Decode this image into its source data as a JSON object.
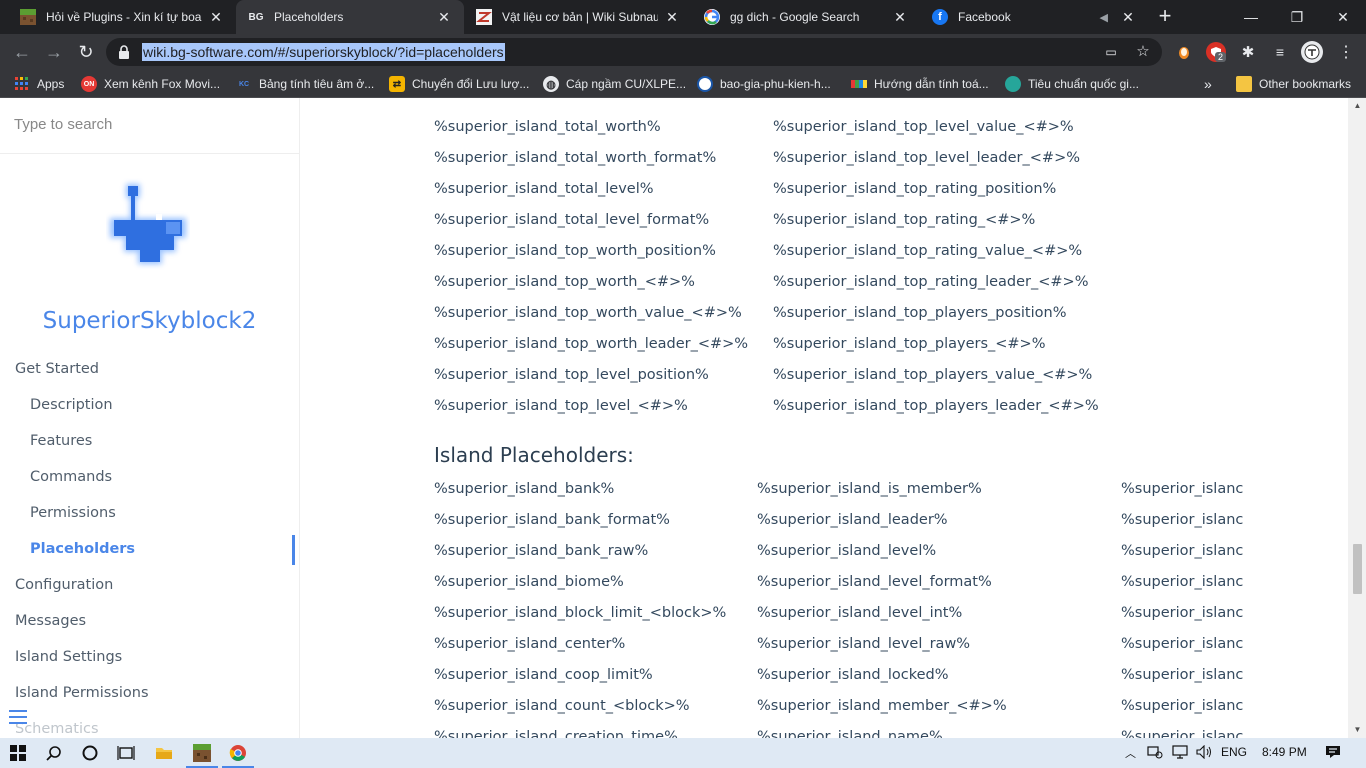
{
  "browser": {
    "tabs": [
      {
        "title": "Hỏi về Plugins - Xin kí tự boarc",
        "icon": "minecraft-icon",
        "active": false
      },
      {
        "title": "Placeholders",
        "icon": "bg-icon",
        "icon_text": "BG",
        "active": true
      },
      {
        "title": "Vật liệu cơ bản | Wiki Subnauti",
        "icon": "wiki-icon",
        "active": false
      },
      {
        "title": "gg dich - Google Search",
        "icon": "google-icon",
        "active": false
      },
      {
        "title": "Facebook",
        "icon": "facebook-icon",
        "active": false
      }
    ],
    "url": "wiki.bg-software.com/#/superiorskyblock/?id=placeholders",
    "extension_badge": "2",
    "bookmarks": [
      {
        "label": "Apps",
        "icon": "apps-grid-icon"
      },
      {
        "label": "Xem kênh Fox Movi...",
        "icon": "fox-on-icon",
        "icon_text": "ON"
      },
      {
        "label": "Bảng tính tiêu âm ở...",
        "icon": "kc-icon",
        "icon_text": "KC"
      },
      {
        "label": "Chuyển đổi Lưu lượ...",
        "icon": "convert-icon"
      },
      {
        "label": "Cáp ngầm CU/XLPE...",
        "icon": "globe-icon"
      },
      {
        "label": "bao-gia-phu-kien-h...",
        "icon": "site-icon"
      },
      {
        "label": "Hướng dẫn tính toá...",
        "icon": "site-bar-icon"
      },
      {
        "label": "Tiêu chuẩn quốc gi...",
        "icon": "site-round-icon"
      }
    ],
    "bookmarks_overflow": "»",
    "other_bookmarks": "Other bookmarks"
  },
  "sidebar": {
    "search_placeholder": "Type to search",
    "app_name": "SuperiorSkyblock2",
    "nav": [
      {
        "label": "Get Started",
        "level": 0
      },
      {
        "label": "Description",
        "level": 1
      },
      {
        "label": "Features",
        "level": 1
      },
      {
        "label": "Commands",
        "level": 1
      },
      {
        "label": "Permissions",
        "level": 1
      },
      {
        "label": "Placeholders",
        "level": 1,
        "active": true
      },
      {
        "label": "Configuration",
        "level": 0
      },
      {
        "label": "Messages",
        "level": 0
      },
      {
        "label": "Island Settings",
        "level": 0
      },
      {
        "label": "Island Permissions",
        "level": 0
      },
      {
        "label": "Schematics",
        "level": 0
      }
    ]
  },
  "main": {
    "top_col1": [
      "%superior_island_total_worth%",
      "%superior_island_total_worth_format%",
      "%superior_island_total_level%",
      "%superior_island_total_level_format%",
      "%superior_island_top_worth_position%",
      "%superior_island_top_worth_<#>%",
      "%superior_island_top_worth_value_<#>%",
      "%superior_island_top_worth_leader_<#>%",
      "%superior_island_top_level_position%",
      "%superior_island_top_level_<#>%"
    ],
    "top_col2": [
      "%superior_island_top_level_value_<#>%",
      "%superior_island_top_level_leader_<#>%",
      "%superior_island_top_rating_position%",
      "%superior_island_top_rating_<#>%",
      "%superior_island_top_rating_value_<#>%",
      "%superior_island_top_rating_leader_<#>%",
      "%superior_island_top_players_position%",
      "%superior_island_top_players_<#>%",
      "%superior_island_top_players_value_<#>%",
      "%superior_island_top_players_leader_<#>%"
    ],
    "island_section_title": "Island Placeholders:",
    "island_col1": [
      "%superior_island_bank%",
      "%superior_island_bank_format%",
      "%superior_island_bank_raw%",
      "%superior_island_biome%",
      "%superior_island_block_limit_<block>%",
      "%superior_island_center%",
      "%superior_island_coop_limit%",
      "%superior_island_count_<block>%",
      "%superior_island_creation_time%"
    ],
    "island_col2": [
      "%superior_island_is_member%",
      "%superior_island_leader%",
      "%superior_island_level%",
      "%superior_island_level_format%",
      "%superior_island_level_int%",
      "%superior_island_level_raw%",
      "%superior_island_locked%",
      "%superior_island_member_<#>%",
      "%superior_island_name%"
    ],
    "island_col3": [
      "%superior_islanc",
      "%superior_islanc",
      "%superior_islanc",
      "%superior_islanc",
      "%superior_islanc",
      "%superior_islanc",
      "%superior_islanc",
      "%superior_islanc",
      "%superior_islanc"
    ]
  },
  "taskbar": {
    "language": "ENG",
    "time": "8:49 PM"
  },
  "colors": {
    "accent": "#4a86e8",
    "chrome_dark": "#202124",
    "chrome_toolbar": "#35363a",
    "text": "#34495e"
  }
}
